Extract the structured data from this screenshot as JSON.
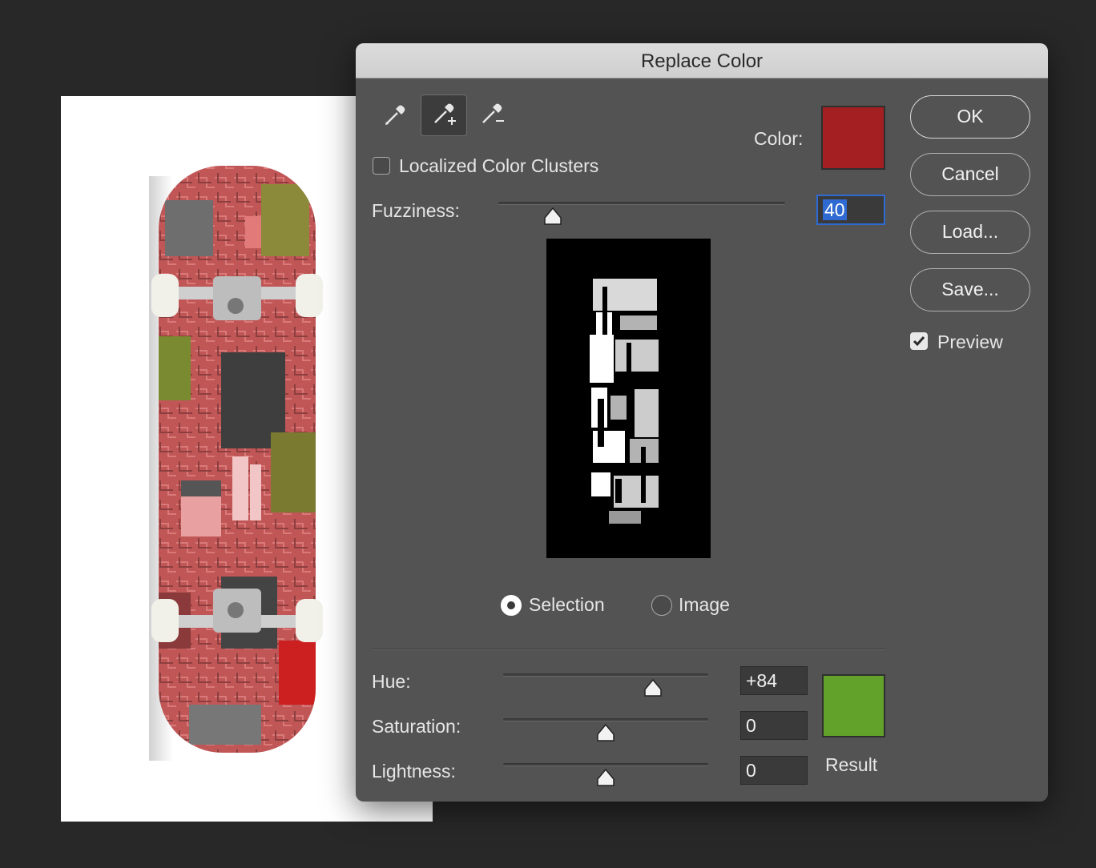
{
  "dialog": {
    "title": "Replace Color",
    "tools": [
      "eyedropper-icon",
      "eyedropper-plus-icon",
      "eyedropper-minus-icon"
    ],
    "color_label": "Color:",
    "selected_color": "#a31f21",
    "localized_label": "Localized Color Clusters",
    "localized_checked": false,
    "fuzziness_label": "Fuzziness:",
    "fuzziness_value": "40",
    "fuzziness_fraction": 0.19,
    "view_options": {
      "selection_label": "Selection",
      "image_label": "Image",
      "selected": "Selection"
    },
    "hue_label": "Hue:",
    "hue_value": "+84",
    "hue_fraction": 0.73,
    "saturation_label": "Saturation:",
    "saturation_value": "0",
    "saturation_fraction": 0.5,
    "lightness_label": "Lightness:",
    "lightness_value": "0",
    "lightness_fraction": 0.5,
    "result_label": "Result",
    "result_color": "#62a22b",
    "buttons": {
      "ok": "OK",
      "cancel": "Cancel",
      "load": "Load...",
      "save": "Save..."
    },
    "preview_label": "Preview",
    "preview_checked": true
  }
}
